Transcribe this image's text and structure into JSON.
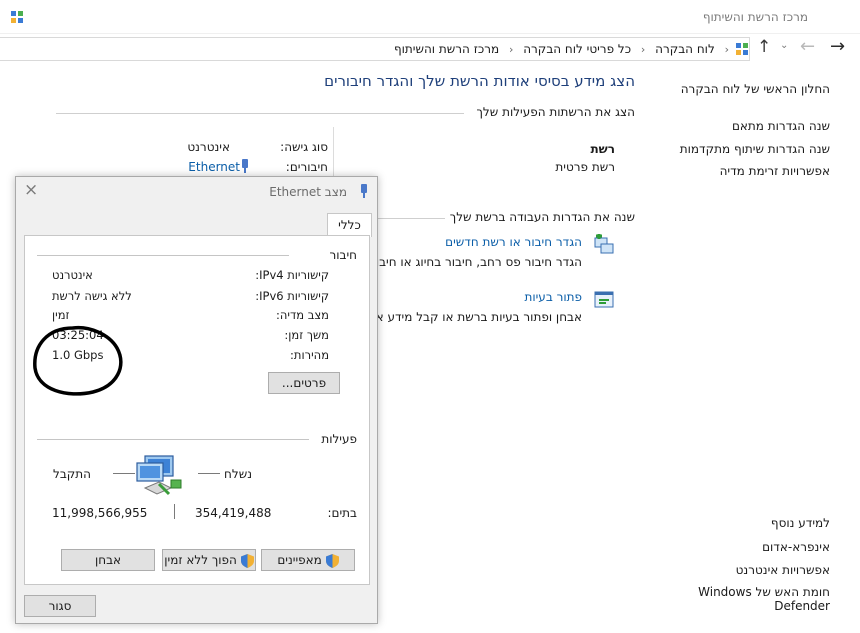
{
  "window": {
    "title": "מרכז הרשת והשיתוף"
  },
  "address": {
    "breadcrumb": [
      "לוח הבקרה",
      "כל פריטי לוח הבקרה",
      "מרכז הרשת והשיתוף"
    ]
  },
  "sidebar": {
    "home": "החלון הראשי של לוח הבקרה",
    "items": [
      "שנה הגדרות מתאם",
      "שנה הגדרות שיתוף מתקדמות",
      "אפשרויות זרימת מדיה"
    ],
    "see_also_title": "למידע נוסף",
    "see_also": [
      "אינפרא-אדום",
      "אפשרויות אינטרנט",
      "חומת האש של Windows Defender"
    ]
  },
  "main": {
    "title": "הצג מידע בסיסי אודות הרשת שלך והגדר חיבורים",
    "active_heading": "הצג את הרשתות הפעילות שלך",
    "network_name": "רשת",
    "network_type": "רשת פרטית",
    "access_type_label": "סוג גישה:",
    "access_type_value": "אינטרנט",
    "connections_label": "חיבורים:",
    "connections_value": "Ethernet",
    "change_heading": "שנה את הגדרות העבודה ברשת שלך",
    "tasks": [
      {
        "title": "הגדר חיבור או רשת חדשים",
        "desc": "הגדר חיבור פס רחב, חיבור בחיוג או חיבו"
      },
      {
        "title": "פתור בעיות",
        "desc": "אבחן ופתור בעיות ברשת או קבל מידע א"
      }
    ]
  },
  "dialog": {
    "title": "מצב Ethernet",
    "tab": "כללי",
    "connection_group": "חיבור",
    "rows": [
      {
        "label": "קישוריות IPv4:",
        "value": "אינטרנט"
      },
      {
        "label": "קישוריות IPv6:",
        "value": "ללא גישה לרשת"
      },
      {
        "label": "מצב מדיה:",
        "value": "זמין"
      },
      {
        "label": "משך זמן:",
        "value": "03:25:04"
      },
      {
        "label": "מהירות:",
        "value": "1.0 Gbps"
      }
    ],
    "details_button": "פרטים...",
    "activity_group": "פעילות",
    "sent_label": "נשלח",
    "received_label": "התקבל",
    "bytes_label": "בתים:",
    "bytes_sent": "354,419,488",
    "bytes_received": "11,998,566,955",
    "buttons": {
      "properties": "מאפיינים",
      "disable": "הפוך ללא זמין",
      "diagnose": "אבחן"
    },
    "close_button": "סגור"
  },
  "icons": {
    "title": "network-center-icon",
    "back": "back-arrow-icon",
    "forward": "forward-arrow-icon",
    "up": "up-arrow-icon",
    "connection": "ethernet-plug-icon",
    "setup": "new-connection-icon",
    "troubleshoot": "troubleshoot-icon",
    "activity": "network-computer-icon",
    "shield": "uac-shield-icon"
  },
  "colors": {
    "link": "#0b5ea8",
    "title": "#1e3f7a",
    "annotation": "#000000"
  }
}
